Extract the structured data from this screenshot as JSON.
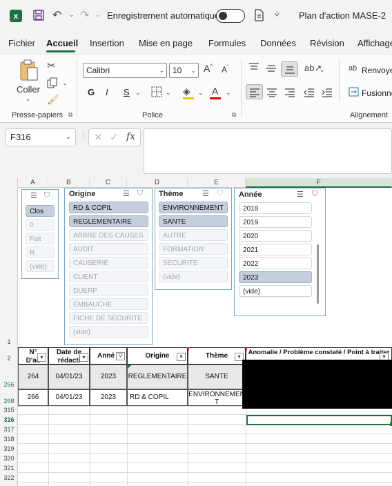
{
  "titlebar": {
    "autosave_label": "Enregistrement automatique",
    "doc_title": "Plan d'action  MASE-2"
  },
  "tabs": [
    "Fichier",
    "Accueil",
    "Insertion",
    "Mise en page",
    "Formules",
    "Données",
    "Révision",
    "Affichage"
  ],
  "ribbon": {
    "paste_label": "Coller",
    "clipboard_group": "Presse-papiers",
    "font_name": "Calibri",
    "font_size": "10",
    "font_group": "Police",
    "bold": "G",
    "italic": "I",
    "underline": "S",
    "wrap_label": "Renvoyer",
    "merge_label": "Fusionner",
    "alignment_group": "Alignement"
  },
  "formula_bar": {
    "name_box": "F316",
    "fx": "fx",
    "formula_value": ""
  },
  "columns": [
    "A",
    "B",
    "C",
    "D",
    "E",
    "F"
  ],
  "row_numbers": [
    "1",
    "2",
    "266",
    "268",
    "315",
    "316",
    "317",
    "318",
    "319",
    "320",
    "321",
    "322"
  ],
  "slicers": {
    "etat": {
      "title": "",
      "items": [
        {
          "label": "Clos",
          "state": "sel"
        },
        {
          "label": "0",
          "state": "nodata"
        },
        {
          "label": "Fait",
          "state": "nodata"
        },
        {
          "label": "R",
          "state": "nodata"
        },
        {
          "label": "(vide)",
          "state": "empty"
        }
      ]
    },
    "origine": {
      "title": "Origine",
      "items": [
        {
          "label": "RD & COPIL",
          "state": "sel"
        },
        {
          "label": "REGLEMENTAIRE",
          "state": "sel"
        },
        {
          "label": "ARBRE DES CAUSES",
          "state": "nodata"
        },
        {
          "label": "AUDIT",
          "state": "nodata"
        },
        {
          "label": "CAUSERIE",
          "state": "nodata"
        },
        {
          "label": "CLIENT",
          "state": "nodata"
        },
        {
          "label": "DUERP",
          "state": "nodata"
        },
        {
          "label": "EMBAUCHE",
          "state": "nodata"
        },
        {
          "label": "FICHE DE SECURITE",
          "state": "nodata"
        },
        {
          "label": "(vide)",
          "state": "empty"
        }
      ]
    },
    "theme": {
      "title": "Thème",
      "items": [
        {
          "label": "ENVIRONNEMENT",
          "state": "sel"
        },
        {
          "label": "SANTE",
          "state": "sel"
        },
        {
          "label": "AUTRE",
          "state": "nodata"
        },
        {
          "label": "FORMATION",
          "state": "nodata"
        },
        {
          "label": "SECURITE",
          "state": "nodata"
        },
        {
          "label": "(vide)",
          "state": "empty"
        }
      ]
    },
    "annee": {
      "title": "Année",
      "items": [
        {
          "label": "2018",
          "state": "avail"
        },
        {
          "label": "2019",
          "state": "avail"
        },
        {
          "label": "2020",
          "state": "avail"
        },
        {
          "label": "2021",
          "state": "avail"
        },
        {
          "label": "2022",
          "state": "avail"
        },
        {
          "label": "2023",
          "state": "sel"
        },
        {
          "label": "(vide)",
          "state": "avail"
        }
      ]
    }
  },
  "table": {
    "headers": [
      "N°\nD'ac",
      "Date de\nrédacti",
      "Anné",
      "Origine",
      "Thème",
      "Anomalie / Problème constaté / Point à traiter"
    ],
    "rows": [
      {
        "num": "264",
        "date": "04/01/23",
        "year": "2023",
        "origine": "REGLEMENTAIRE",
        "theme": "SANTE"
      },
      {
        "num": "266",
        "date": "04/01/23",
        "year": "2023",
        "origine": "RD & COPIL",
        "theme": "ENVIRONNEMENT"
      }
    ]
  }
}
